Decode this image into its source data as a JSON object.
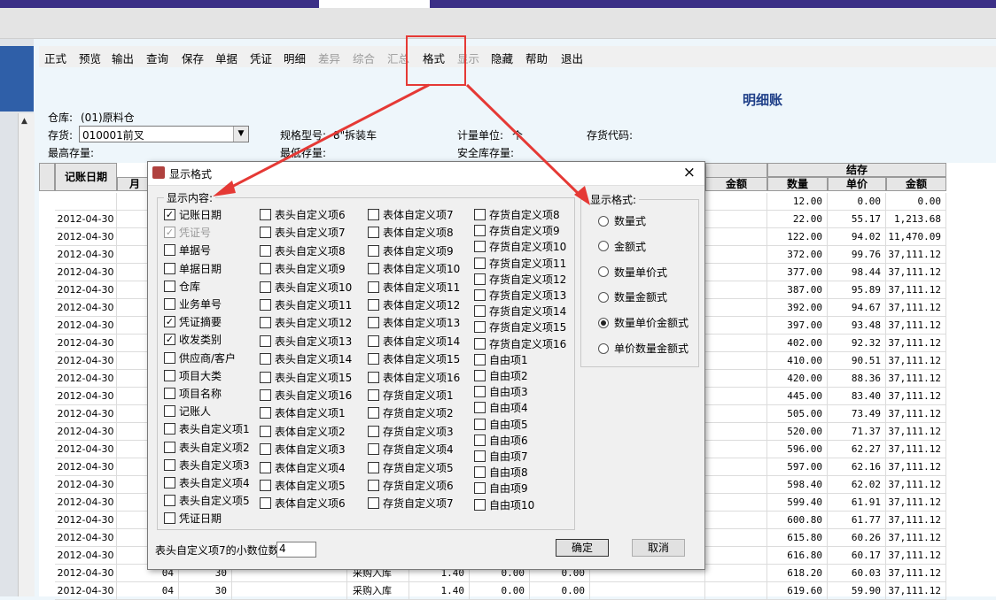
{
  "toolbar": [
    "正式",
    "预览",
    "输出",
    "查询",
    "保存",
    "单据",
    "凭证",
    "明细",
    "差异",
    "综合",
    "汇总",
    "格式",
    "显示",
    "隐藏",
    "帮助",
    "退出"
  ],
  "toolbar_disabled": [
    false,
    false,
    false,
    false,
    false,
    false,
    false,
    false,
    true,
    true,
    true,
    false,
    true,
    false,
    false,
    false
  ],
  "report": {
    "title": "明细账",
    "warehouse_label": "仓库:",
    "warehouse_value": "(01)原料仓",
    "stock_label": "存货:",
    "stock_value": "010001前叉",
    "spec_label": "规格型号:",
    "spec_value": "8\"拆装车",
    "unit_label": "计量单位:",
    "unit_value": "个",
    "code_label": "存货代码:",
    "max_label": "最高存量:",
    "min_label": "最低存量:",
    "safe_label": "安全库存量:"
  },
  "grid": {
    "col_date": "记账日期",
    "col_month": "月",
    "col_balance": "结存",
    "col_amount_prev": "金额",
    "col_qty": "数量",
    "col_price": "单价",
    "col_amount": "金额",
    "rows": [
      {
        "date": "",
        "qty": "12.00",
        "price": "0.00",
        "amount": "0.00"
      },
      {
        "date": "2012-04-30",
        "qty": "22.00",
        "price": "55.17",
        "amount": "1,213.68"
      },
      {
        "date": "2012-04-30",
        "qty": "122.00",
        "price": "94.02",
        "amount": "11,470.09"
      },
      {
        "date": "2012-04-30",
        "qty": "372.00",
        "price": "99.76",
        "amount": "37,111.12"
      },
      {
        "date": "2012-04-30",
        "qty": "377.00",
        "price": "98.44",
        "amount": "37,111.12"
      },
      {
        "date": "2012-04-30",
        "qty": "387.00",
        "price": "95.89",
        "amount": "37,111.12"
      },
      {
        "date": "2012-04-30",
        "qty": "392.00",
        "price": "94.67",
        "amount": "37,111.12"
      },
      {
        "date": "2012-04-30",
        "qty": "397.00",
        "price": "93.48",
        "amount": "37,111.12"
      },
      {
        "date": "2012-04-30",
        "qty": "402.00",
        "price": "92.32",
        "amount": "37,111.12"
      },
      {
        "date": "2012-04-30",
        "qty": "410.00",
        "price": "90.51",
        "amount": "37,111.12"
      },
      {
        "date": "2012-04-30",
        "qty": "420.00",
        "price": "88.36",
        "amount": "37,111.12"
      },
      {
        "date": "2012-04-30",
        "qty": "445.00",
        "price": "83.40",
        "amount": "37,111.12"
      },
      {
        "date": "2012-04-30",
        "qty": "505.00",
        "price": "73.49",
        "amount": "37,111.12"
      },
      {
        "date": "2012-04-30",
        "qty": "520.00",
        "price": "71.37",
        "amount": "37,111.12"
      },
      {
        "date": "2012-04-30",
        "qty": "596.00",
        "price": "62.27",
        "amount": "37,111.12"
      },
      {
        "date": "2012-04-30",
        "qty": "597.00",
        "price": "62.16",
        "amount": "37,111.12"
      },
      {
        "date": "2012-04-30",
        "qty": "598.40",
        "price": "62.02",
        "amount": "37,111.12"
      },
      {
        "date": "2012-04-30",
        "qty": "599.40",
        "price": "61.91",
        "amount": "37,111.12"
      },
      {
        "date": "2012-04-30",
        "qty": "600.80",
        "price": "61.77",
        "amount": "37,111.12"
      },
      {
        "date": "2012-04-30",
        "qty": "615.80",
        "price": "60.26",
        "amount": "37,111.12"
      },
      {
        "date": "2012-04-30",
        "qty": "616.80",
        "price": "60.17",
        "amount": "37,111.12"
      },
      {
        "date": "2012-04-30",
        "month": "04",
        "day": "30",
        "type": "采购入库",
        "in_qty": "1.40",
        "in_price": "0.00",
        "in_amount": "0.00",
        "qty": "618.20",
        "price": "60.03",
        "amount": "37,111.12"
      },
      {
        "date": "2012-04-30",
        "month": "04",
        "day": "30",
        "type": "采购入库",
        "in_qty": "1.40",
        "in_price": "0.00",
        "in_amount": "0.00",
        "qty": "619.60",
        "price": "59.90",
        "amount": "37,111.12"
      }
    ]
  },
  "dialog": {
    "title": "显示格式",
    "content_group": "显示内容:",
    "format_group": "显示格式:",
    "col1": [
      {
        "label": "记账日期",
        "checked": true,
        "disabled": false
      },
      {
        "label": "凭证号",
        "checked": true,
        "disabled": true
      },
      {
        "label": "单据号",
        "checked": false,
        "disabled": false
      },
      {
        "label": "单据日期",
        "checked": false,
        "disabled": false
      },
      {
        "label": "仓库",
        "checked": false,
        "disabled": false
      },
      {
        "label": "业务单号",
        "checked": false,
        "disabled": false
      },
      {
        "label": "凭证摘要",
        "checked": true,
        "disabled": false
      },
      {
        "label": "收发类别",
        "checked": true,
        "disabled": false
      },
      {
        "label": "供应商/客户",
        "checked": false,
        "disabled": false
      },
      {
        "label": "项目大类",
        "checked": false,
        "disabled": false
      },
      {
        "label": "项目名称",
        "checked": false,
        "disabled": false
      },
      {
        "label": "记账人",
        "checked": false,
        "disabled": false
      },
      {
        "label": "表头自定义项1",
        "checked": false,
        "disabled": false
      },
      {
        "label": "表头自定义项2",
        "checked": false,
        "disabled": false
      },
      {
        "label": "表头自定义项3",
        "checked": false,
        "disabled": false
      },
      {
        "label": "表头自定义项4",
        "checked": false,
        "disabled": false
      },
      {
        "label": "表头自定义项5",
        "checked": false,
        "disabled": false
      },
      {
        "label": "凭证日期",
        "checked": false,
        "disabled": false
      }
    ],
    "col2": [
      "表头自定义项6",
      "表头自定义项7",
      "表头自定义项8",
      "表头自定义项9",
      "表头自定义项10",
      "表头自定义项11",
      "表头自定义项12",
      "表头自定义项13",
      "表头自定义项14",
      "表头自定义项15",
      "表头自定义项16",
      "表体自定义项1",
      "表体自定义项2",
      "表体自定义项3",
      "表体自定义项4",
      "表体自定义项5",
      "表体自定义项6"
    ],
    "col3": [
      "表体自定义项7",
      "表体自定义项8",
      "表体自定义项9",
      "表体自定义项10",
      "表体自定义项11",
      "表体自定义项12",
      "表体自定义项13",
      "表体自定义项14",
      "表体自定义项15",
      "表体自定义项16",
      "存货自定义项1",
      "存货自定义项2",
      "存货自定义项3",
      "存货自定义项4",
      "存货自定义项5",
      "存货自定义项6",
      "存货自定义项7"
    ],
    "col4": [
      "存货自定义项8",
      "存货自定义项9",
      "存货自定义项10",
      "存货自定义项11",
      "存货自定义项12",
      "存货自定义项13",
      "存货自定义项14",
      "存货自定义项15",
      "存货自定义项16",
      "自由项1",
      "自由项2",
      "自由项3",
      "自由项4",
      "自由项5",
      "自由项6",
      "自由项7",
      "自由项8",
      "自由项9",
      "自由项10"
    ],
    "formats": [
      {
        "label": "数量式",
        "selected": false
      },
      {
        "label": "金额式",
        "selected": false
      },
      {
        "label": "数量单价式",
        "selected": false
      },
      {
        "label": "数量金额式",
        "selected": false
      },
      {
        "label": "数量单价金额式",
        "selected": true
      },
      {
        "label": "单价数量金额式",
        "selected": false
      }
    ],
    "decimal_label": "表头自定义项7的小数位数",
    "decimal_value": "4",
    "ok": "确定",
    "cancel": "取消",
    "close": "×"
  },
  "colors": {
    "annotation": "#e53935",
    "title_blue": "#1f3f88",
    "top_bar": "#3b2f86"
  }
}
